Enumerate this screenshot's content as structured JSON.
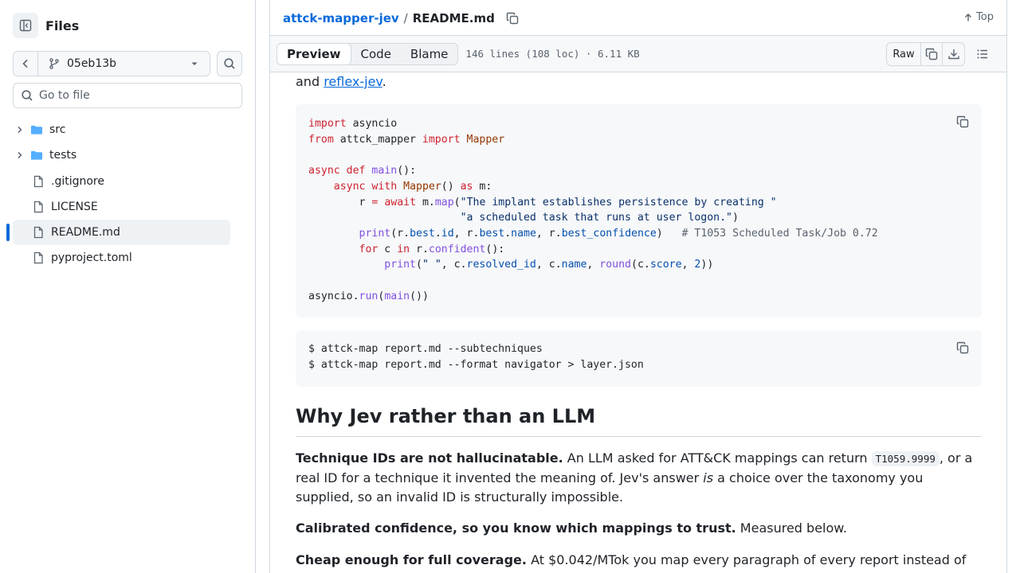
{
  "sidebar": {
    "title": "Files",
    "branch": "05eb13b",
    "search_placeholder": "Go to file",
    "tree": [
      {
        "label": "src",
        "type": "folder"
      },
      {
        "label": "tests",
        "type": "folder"
      },
      {
        "label": ".gitignore",
        "type": "file"
      },
      {
        "label": "LICENSE",
        "type": "file"
      },
      {
        "label": "README.md",
        "type": "file",
        "active": true
      },
      {
        "label": "pyproject.toml",
        "type": "file"
      }
    ]
  },
  "header": {
    "repo": "attck-mapper-jev",
    "separator": "/",
    "file": "README.md",
    "top_label": "Top"
  },
  "toolbar": {
    "tabs": [
      "Preview",
      "Code",
      "Blame"
    ],
    "active_tab": "Preview",
    "meta": "146 lines (108 loc) · 6.11 KB",
    "raw_label": "Raw"
  },
  "content": {
    "intro_prefix": "and ",
    "intro_link": "reflex-jev",
    "intro_suffix": ".",
    "code_python": [
      "import asyncio",
      "from attck_mapper import Mapper",
      "",
      "async def main():",
      "    async with Mapper() as m:",
      "        r = await m.map(\"The implant establishes persistence by creating \"",
      "                        \"a scheduled task that runs at user logon.\")",
      "        print(r.best.id, r.best.name, r.best_confidence)   # T1053 Scheduled Task/Job 0.72",
      "        for c in r.confident():",
      "            print(\" \", c.resolved_id, c.name, round(c.score, 2))",
      "",
      "asyncio.run(main())"
    ],
    "code_shell": [
      "$ attck-map report.md --subtechniques",
      "$ attck-map report.md --format navigator > layer.json"
    ],
    "heading": "Why Jev rather than an LLM",
    "p1_bold": "Technique IDs are not hallucinatable.",
    "p1_a": " An LLM asked for ATT&CK mappings can return ",
    "p1_code": "T1059.9999",
    "p1_b": ", or a real ID for a technique it invented the meaning of. Jev's answer ",
    "p1_em": "is",
    "p1_c": " a choice over the taxonomy you supplied, so an invalid ID is structurally impossible.",
    "p2_bold": "Calibrated confidence, so you know which mappings to trust.",
    "p2_rest": " Measured below.",
    "p3_bold": "Cheap enough for full coverage.",
    "p3_rest": " At $0.042/MTok you map every paragraph of every report instead of"
  },
  "colors": {
    "accent": "#0969da",
    "border": "#d1d9e0",
    "code_bg": "#f6f8fa"
  }
}
